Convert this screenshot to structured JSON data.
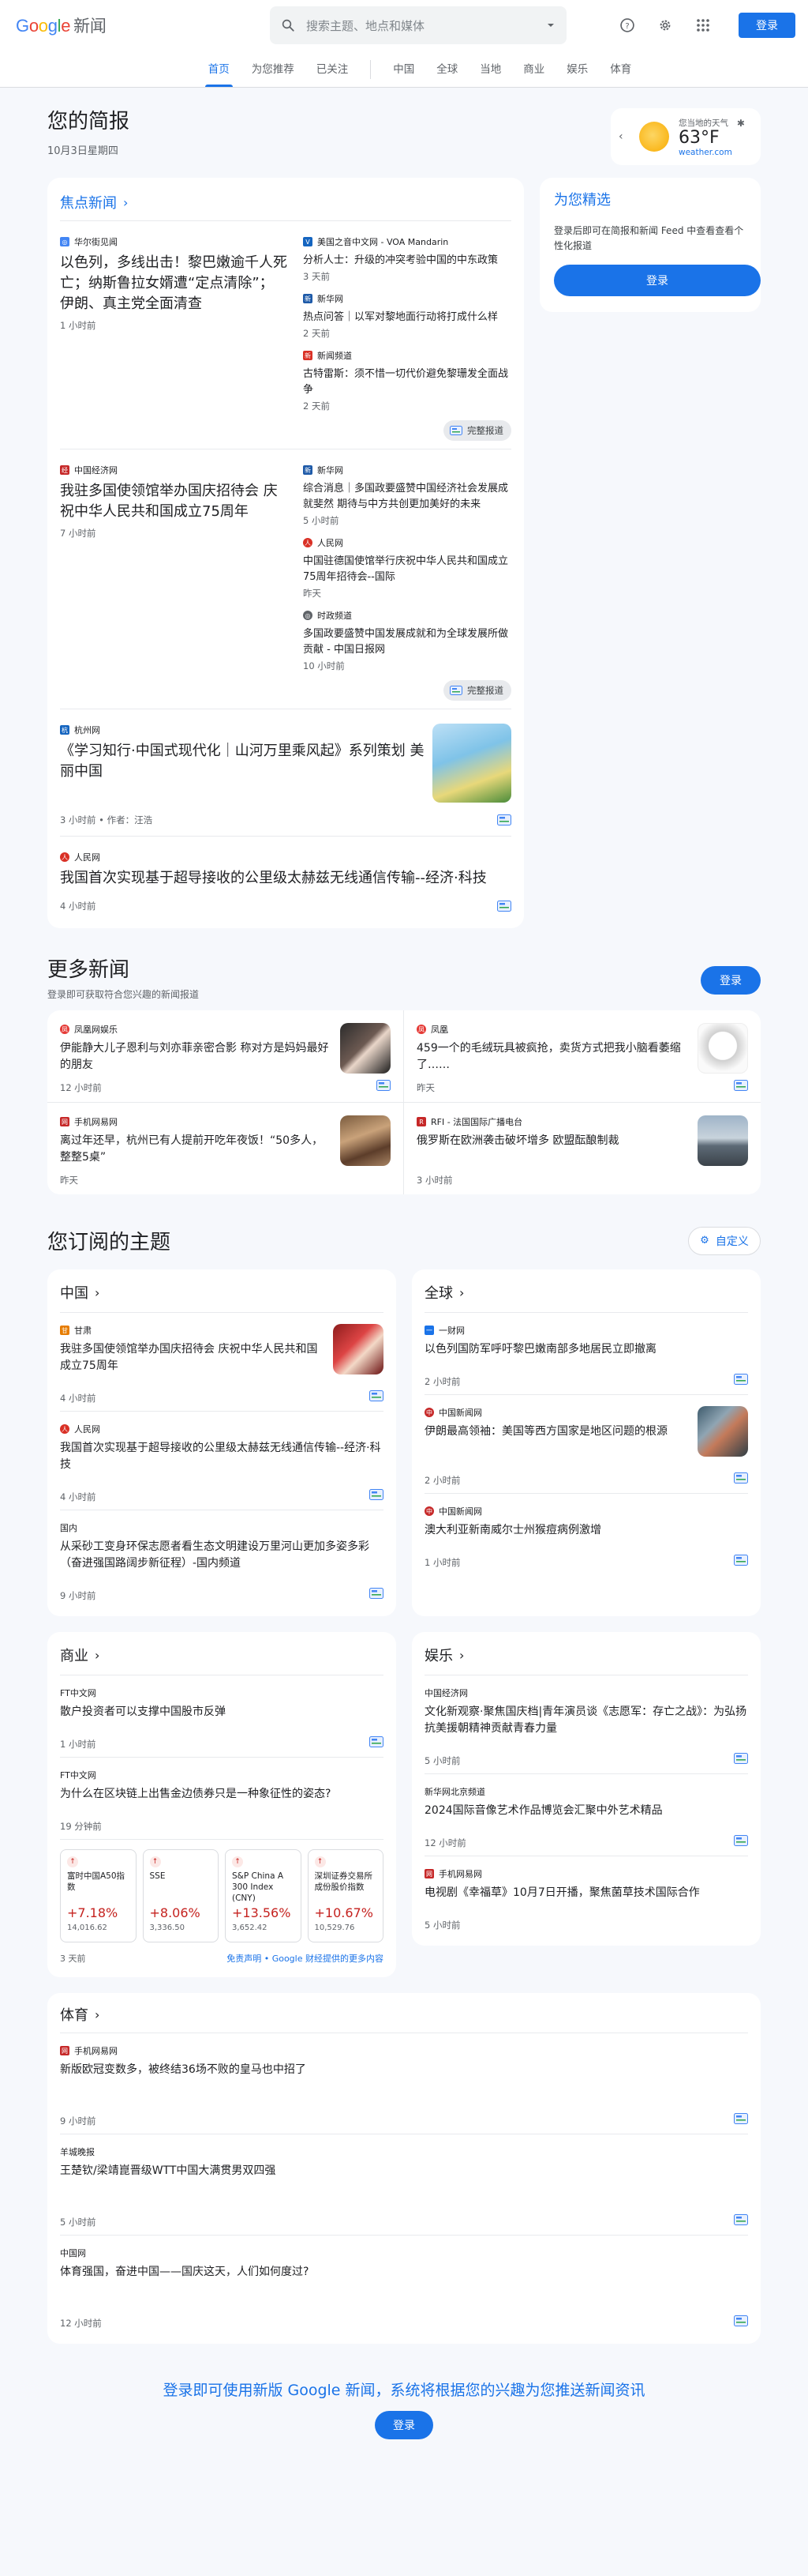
{
  "header": {
    "logo_parts": [
      "G",
      "o",
      "o",
      "g",
      "l",
      "e"
    ],
    "logo_news": "新闻",
    "search_placeholder": "搜索主题、地点和媒体",
    "signin": "登录"
  },
  "nav": {
    "tabs": [
      "首页",
      "为您推荐",
      "已关注"
    ],
    "sections": [
      "中国",
      "全球",
      "当地",
      "商业",
      "娱乐",
      "体育"
    ]
  },
  "briefing": {
    "title": "您的简报",
    "date": "10月3日星期四",
    "weather": {
      "location": "您当地的天气",
      "temp": "63°F",
      "source": "weather.com"
    }
  },
  "top_stories": {
    "label": "焦点新闻",
    "clusters": [
      {
        "lead": {
          "source": "华尔街见闻",
          "title": "以色列，多线出击！黎巴嫩逾千人死亡；纳斯鲁拉女婿遭“定点清除”；伊朗、真主党全面清查",
          "time": "1 小时前"
        },
        "side": [
          {
            "source": "美国之音中文网 - VOA Mandarin",
            "title": "分析人士：升级的冲突考验中国的中东政策",
            "time": "3 天前"
          },
          {
            "source": "新华网",
            "title": "热点问答｜以军对黎地面行动将打成什么样",
            "time": "2 天前"
          },
          {
            "source": "新闻频道",
            "title": "古特雷斯：须不惜一切代价避免黎珊发全面战争",
            "time": "2 天前"
          }
        ],
        "coverage": "完整报道"
      },
      {
        "lead": {
          "source": "中国经济网",
          "title": "我驻多国使领馆举办国庆招待会 庆祝中华人民共和国成立75周年",
          "time": "7 小时前"
        },
        "side": [
          {
            "source": "新华网",
            "title": "综合消息｜多国政要盛赞中国经济社会发展成就斐然 期待与中方共创更加美好的未来",
            "time": "5 小时前"
          },
          {
            "source": "人民网",
            "title": "中国驻德国使馆举行庆祝中华人民共和国成立75周年招待会--国际",
            "time": "昨天"
          },
          {
            "source": "时政频道",
            "title": "多国政要盛赞中国发展成就和为全球发展所做贡献 - 中国日报网",
            "time": "10 小时前"
          }
        ],
        "coverage": "完整报道"
      }
    ],
    "singles": [
      {
        "source": "杭州网",
        "title": "《学习知行·中国式现代化｜山河万里乘风起》系列策划 美丽中国",
        "time": "3 小时前",
        "author": "作者：汪浩"
      },
      {
        "source": "人民网",
        "title": "我国首次实现基于超导接收的公里级太赫兹无线通信传输--经济·科技",
        "time": "4 小时前"
      }
    ]
  },
  "picks": {
    "title": "为您精选",
    "desc": "登录后即可在简报和新闻 Feed 中查看查看个性化报道",
    "button": "登录"
  },
  "more_news": {
    "title": "更多新闻",
    "subtitle": "登录即可获取符合您兴趣的新闻报道",
    "button": "登录",
    "items": [
      {
        "source": "凤凰网娱乐",
        "title": "伊能静大儿子恩利与刘亦菲亲密合影 称对方是妈妈最好的朋友",
        "time": "12 小时前"
      },
      {
        "source": "凤凰",
        "title": "459一个的毛绒玩具被疯抢，卖货方式把我小脑看萎缩了……",
        "time": "昨天"
      },
      {
        "source": "手机网易网",
        "title": "离过年还早，杭州已有人提前开吃年夜饭！“50多人，整整5桌”",
        "time": "昨天"
      },
      {
        "source": "RFI - 法国国际广播电台",
        "title": "俄罗斯在欧洲袭击破坏增多 欧盟酝酿制裁",
        "time": "3 小时前"
      }
    ]
  },
  "topics": {
    "title": "您订阅的主题",
    "customize": "自定义",
    "china": {
      "label": "中国",
      "items": [
        {
          "source": "甘肃",
          "title": "我驻多国使领馆举办国庆招待会 庆祝中华人民共和国成立75周年",
          "time": "4 小时前"
        },
        {
          "source": "人民网",
          "title": "我国首次实现基于超导接收的公里级太赫兹无线通信传输--经济·科技",
          "time": "4 小时前"
        },
        {
          "source": "国内",
          "title": "从采砂工变身环保志愿者看生态文明建设万里河山更加多姿多彩（奋进强国路阔步新征程）-国内频道",
          "time": "9 小时前"
        }
      ]
    },
    "world": {
      "label": "全球",
      "items": [
        {
          "source": "一财网",
          "title": "以色列国防军呼吁黎巴嫩南部多地居民立即撤离",
          "time": "2 小时前"
        },
        {
          "source": "中国新闻网",
          "title": "伊朗最高领袖：美国等西方国家是地区问题的根源",
          "time": "2 小时前"
        },
        {
          "source": "中国新闻网",
          "title": "澳大利亚新南威尔士州猴痘病例激增",
          "time": "1 小时前"
        }
      ]
    },
    "business": {
      "label": "商业",
      "items": [
        {
          "source": "FT中文网",
          "title": "散户投资者可以支撑中国股市反弹",
          "time": "1 小时前"
        },
        {
          "source": "FT中文网",
          "title": "为什么在区块链上出售金边债券只是一种象征性的姿态?",
          "time": "19 分钟前"
        }
      ],
      "stocks": [
        {
          "name": "富时中国A50指数",
          "change": "+7.18%",
          "value": "14,016.62"
        },
        {
          "name": "SSE",
          "change": "+8.06%",
          "value": "3,336.50"
        },
        {
          "name": "S&P China A 300 Index (CNY)",
          "change": "+13.56%",
          "value": "3,652.42"
        },
        {
          "name": "深圳证券交易所成份股价指数",
          "change": "+10.67%",
          "value": "10,529.76"
        }
      ],
      "stock_time": "3 天前",
      "disclaimer": "免责声明 • Google 财经提供的更多内容"
    },
    "entertainment": {
      "label": "娱乐",
      "items": [
        {
          "source": "中国经济网",
          "title": "文化新观察·聚焦国庆档|青年演员谈《志愿军：存亡之战》：为弘扬抗美援朝精神贡献青春力量",
          "time": "5 小时前"
        },
        {
          "source": "新华网北京频道",
          "title": "2024国际音像艺术作品博览会汇聚中外艺术精品",
          "time": "12 小时前"
        },
        {
          "source": "手机网易网",
          "title": "电视剧《幸福草》10月7日开播，聚焦菌草技术国际合作",
          "time": "5 小时前"
        }
      ]
    },
    "sports": {
      "label": "体育",
      "items": [
        {
          "source": "手机网易网",
          "title": "新版欧冠变数多，被终结36场不败的皇马也中招了",
          "time": "9 小时前"
        },
        {
          "source": "羊城晚报",
          "title": "王楚钦/梁靖崑晋级WTT中国大满贯男双四强",
          "time": "5 小时前"
        },
        {
          "source": "中国网",
          "title": "体育强国，奋进中国——国庆这天，人们如何度过?",
          "time": "12 小时前"
        }
      ]
    }
  },
  "footer": {
    "message": "登录即可使用新版 Google 新闻，系统将根据您的兴趣为您推送新闻资讯",
    "button": "登录"
  },
  "colors": {
    "accent": "#1a73e8",
    "stock_up": "#c5221f",
    "page_bg": "#f6f8fc"
  }
}
